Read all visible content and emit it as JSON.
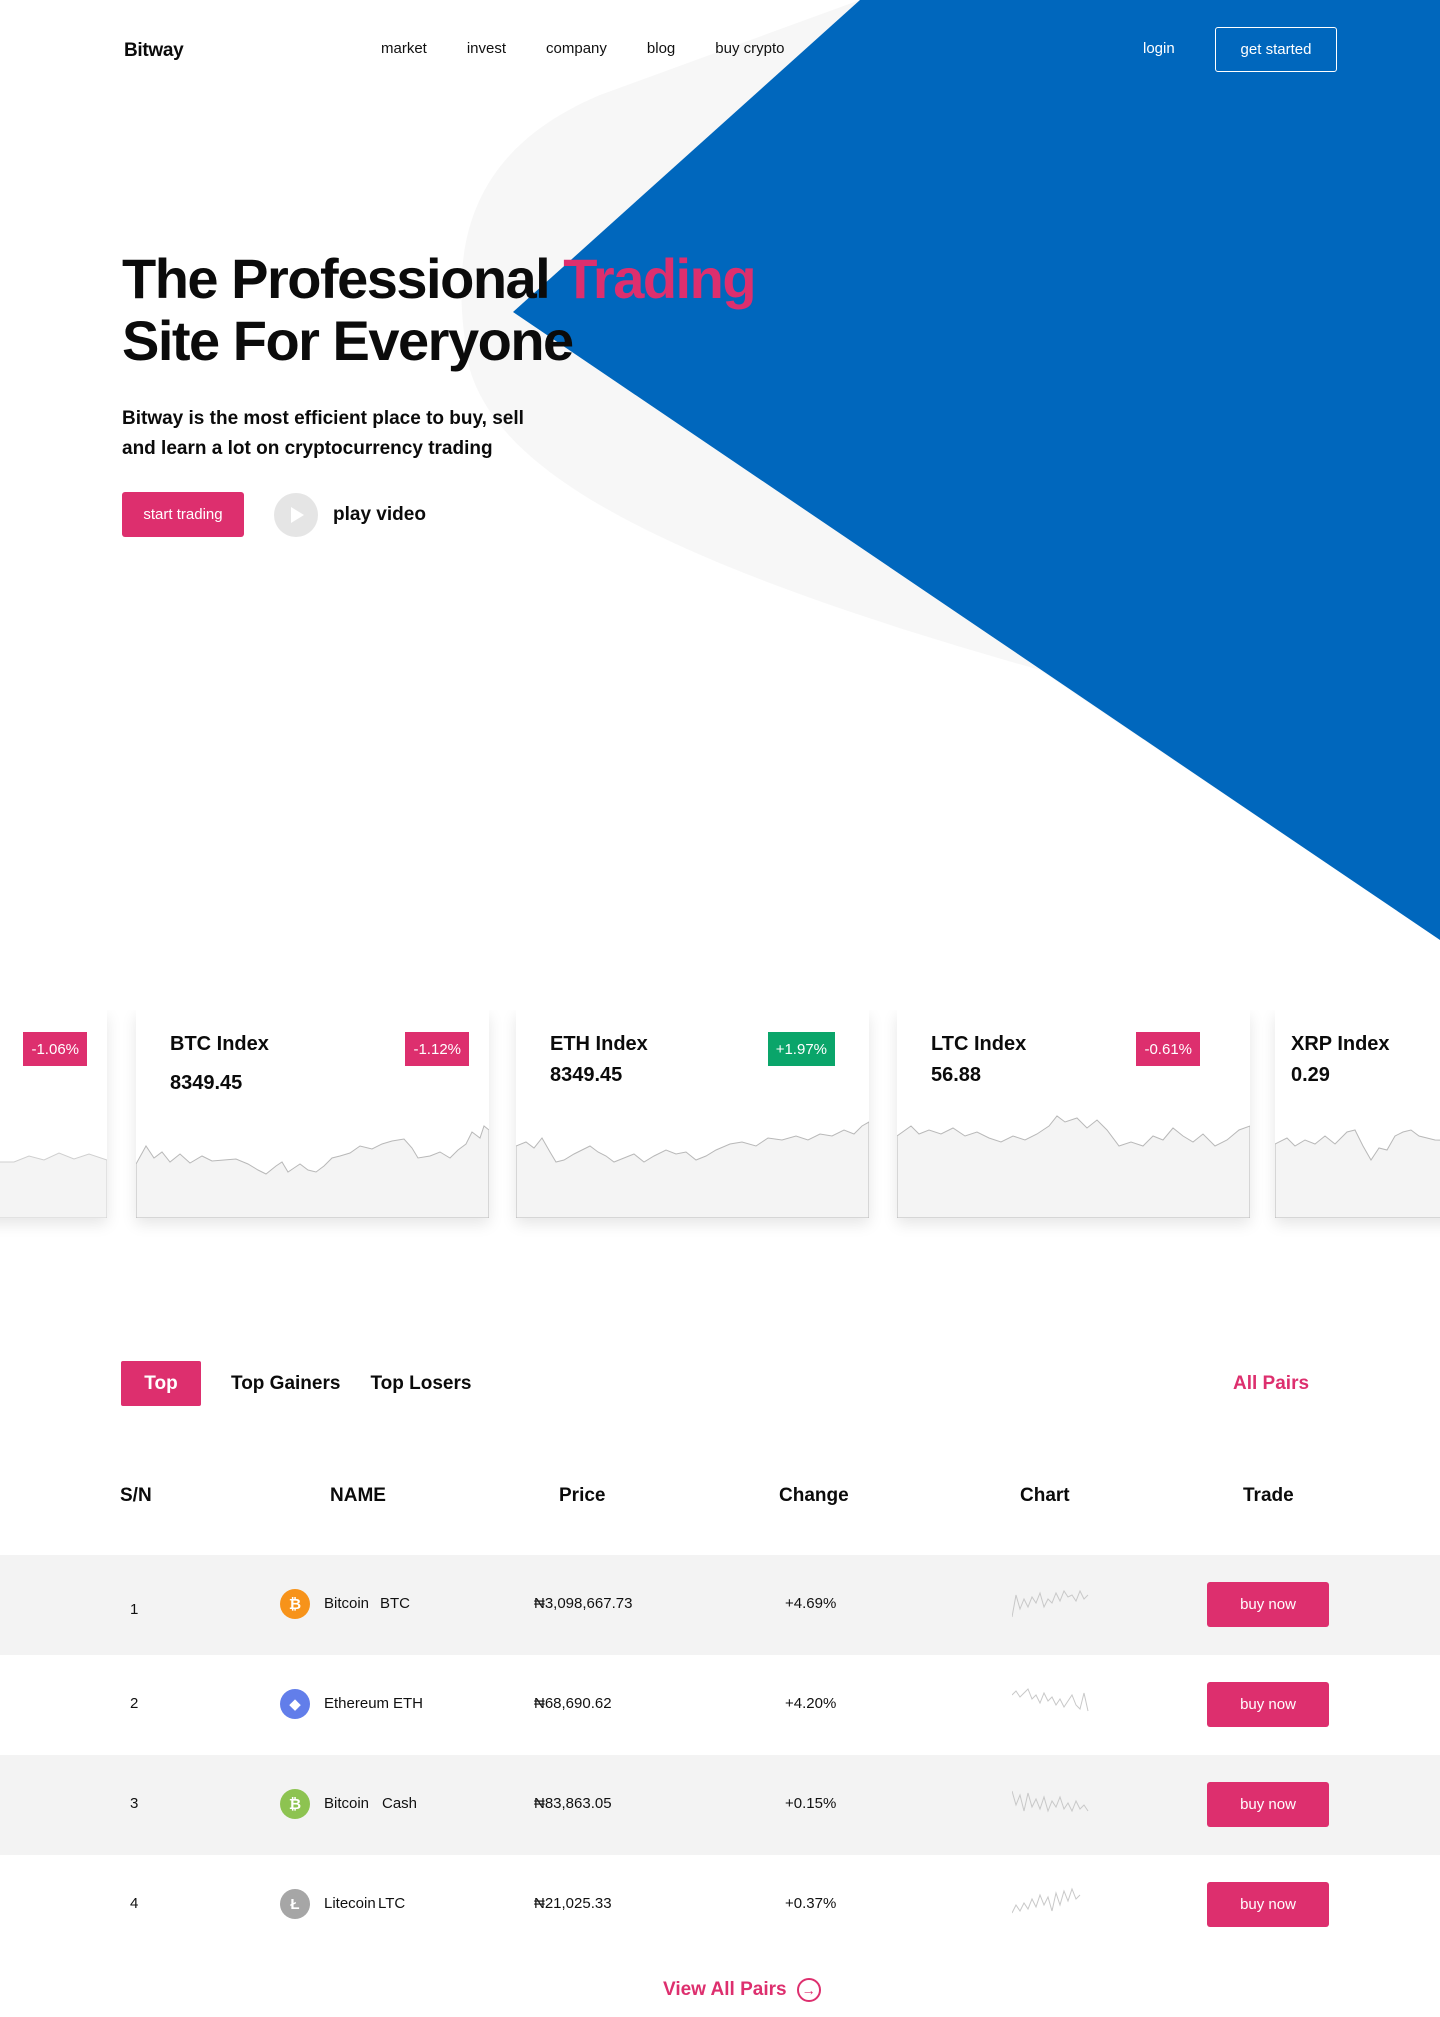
{
  "brand": "Bitway",
  "nav": {
    "links": [
      "market",
      "invest",
      "company",
      "blog",
      "buy crypto"
    ],
    "login": "login",
    "get_started": "get started"
  },
  "hero": {
    "title_part1": "The Professional ",
    "title_accent": "Trading",
    "title_line2": "Site For Everyone",
    "subtitle": "Bitway is the most efficient place to buy, sell and learn a lot on cryptocurrency trading",
    "start_button": "start trading",
    "play_label": "play video"
  },
  "index_cards": [
    {
      "name": "",
      "value": "",
      "change": "-1.06%",
      "trend": "down"
    },
    {
      "name": "BTC Index",
      "value": "8349.45",
      "change": "-1.12%",
      "trend": "down"
    },
    {
      "name": "ETH Index",
      "value": "8349.45",
      "change": "+1.97%",
      "trend": "up"
    },
    {
      "name": "LTC Index",
      "value": "56.88",
      "change": "-0.61%",
      "trend": "down"
    },
    {
      "name": "XRP Index",
      "value": "0.29",
      "change": "",
      "trend": ""
    }
  ],
  "tabs": {
    "items": [
      "Top",
      "Top Gainers",
      "Top Losers"
    ],
    "active": "Top",
    "all_pairs": "All Pairs"
  },
  "table": {
    "headers": [
      "S/N",
      "NAME",
      "Price",
      "Change",
      "Chart",
      "Trade"
    ],
    "rows": [
      {
        "sn": "1",
        "name": "Bitcoin",
        "symbol": "BTC",
        "price": "₦3,098,667.73",
        "change": "+4.69%",
        "icon": "bitcoin-icon",
        "icon_color": "#f7931a",
        "action": "buy now"
      },
      {
        "sn": "2",
        "name": "Ethereum",
        "symbol": "ETH",
        "price": "₦68,690.62",
        "change": "+4.20%",
        "icon": "ethereum-icon",
        "icon_color": "#627eea",
        "action": "buy now"
      },
      {
        "sn": "3",
        "name": "Bitcoin",
        "symbol": "Cash",
        "price": "₦83,863.05",
        "change": "+0.15%",
        "icon": "bitcoin-cash-icon",
        "icon_color": "#8dc351",
        "action": "buy now"
      },
      {
        "sn": "4",
        "name": "Litecoin",
        "symbol": "LTC",
        "price": "₦21,025.33",
        "change": "+0.37%",
        "icon": "litecoin-icon",
        "icon_color": "#a6a6a6",
        "action": "buy now"
      }
    ]
  },
  "view_all": "View All Pairs",
  "colors": {
    "accent": "#dd2f6e",
    "brand_blue": "#0067bd",
    "positive": "#0aa56a",
    "negative": "#dd2f6e"
  }
}
